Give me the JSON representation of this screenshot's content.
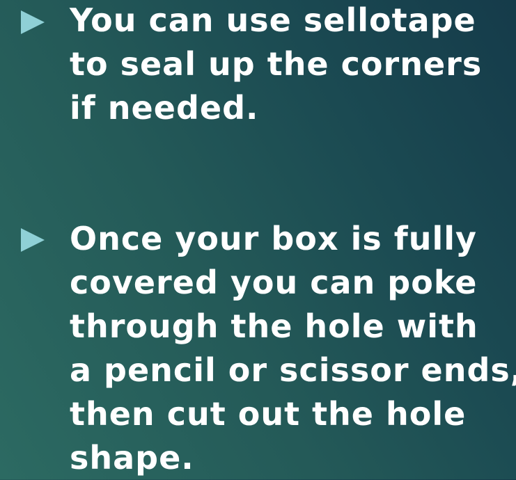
{
  "slide": {
    "bullets": [
      {
        "lines": [
          "You can use sellotape",
          "to seal up the corners",
          "if needed."
        ]
      },
      {
        "lines": [
          "Once your box is fully",
          "covered you can poke",
          "through the hole with",
          "a pencil or scissor ends,",
          "then cut out the hole",
          "shape."
        ]
      }
    ]
  },
  "colors": {
    "background_start": "#2c6a62",
    "background_end": "#153b4a",
    "bullet_marker": "#8fd0d6",
    "text": "#ffffff"
  },
  "icons": {
    "bullet_marker": "triangle-right-icon"
  }
}
